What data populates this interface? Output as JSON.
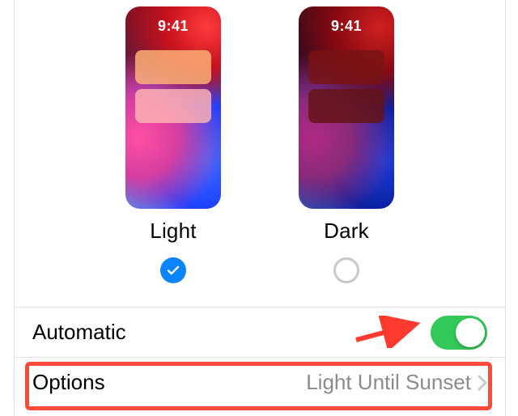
{
  "appearance": {
    "time_display": "9:41",
    "options": [
      {
        "label": "Light",
        "selected": true
      },
      {
        "label": "Dark",
        "selected": false
      }
    ]
  },
  "rows": {
    "automatic": {
      "label": "Automatic",
      "enabled": true
    },
    "options": {
      "label": "Options",
      "value": "Light Until Sunset"
    }
  },
  "colors": {
    "accent_blue": "#0a84ff",
    "toggle_green": "#34c759",
    "annotation_red": "#ff4a3a"
  }
}
